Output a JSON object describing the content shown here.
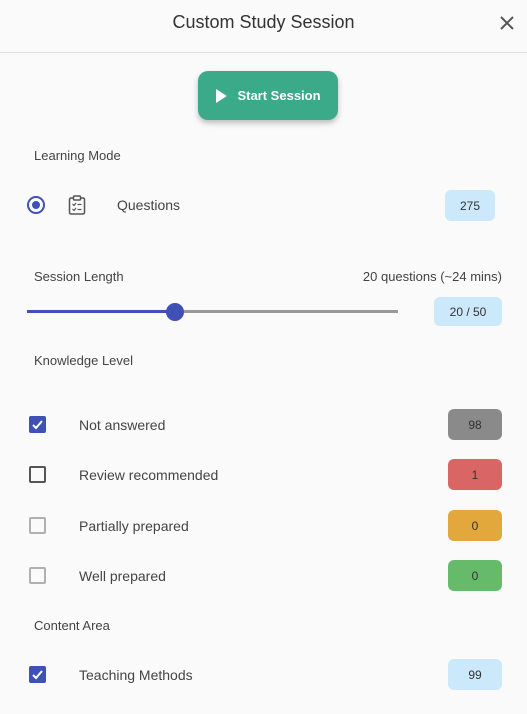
{
  "header": {
    "title": "Custom Study Session",
    "close_icon": "close-icon"
  },
  "start_button": {
    "label": "Start Session",
    "icon": "play-icon",
    "color": "#3aaa88"
  },
  "learning_mode": {
    "label": "Learning Mode",
    "option": {
      "label": "Questions",
      "count": "275",
      "selected": true,
      "icon": "clipboard-list-icon"
    }
  },
  "session_length": {
    "label": "Session Length",
    "info": "20 questions (~24 mins)",
    "value_label": "20 / 50",
    "value": 20,
    "max": 50
  },
  "knowledge_level": {
    "label": "Knowledge Level",
    "items": [
      {
        "label": "Not answered",
        "count": "98",
        "checked": true,
        "badge_color": "#8a8a8a"
      },
      {
        "label": "Review recommended",
        "count": "1",
        "checked": false,
        "badge_color": "#d96565"
      },
      {
        "label": "Partially prepared",
        "count": "0",
        "checked": false,
        "badge_color": "#e3a83b"
      },
      {
        "label": "Well prepared",
        "count": "0",
        "checked": false,
        "badge_color": "#66bb6a"
      }
    ]
  },
  "content_area": {
    "label": "Content Area",
    "item": {
      "label": "Teaching Methods",
      "count": "99",
      "checked": true
    }
  },
  "colors": {
    "accent": "#3f51b5",
    "badge_neutral": "#cce8fb"
  }
}
